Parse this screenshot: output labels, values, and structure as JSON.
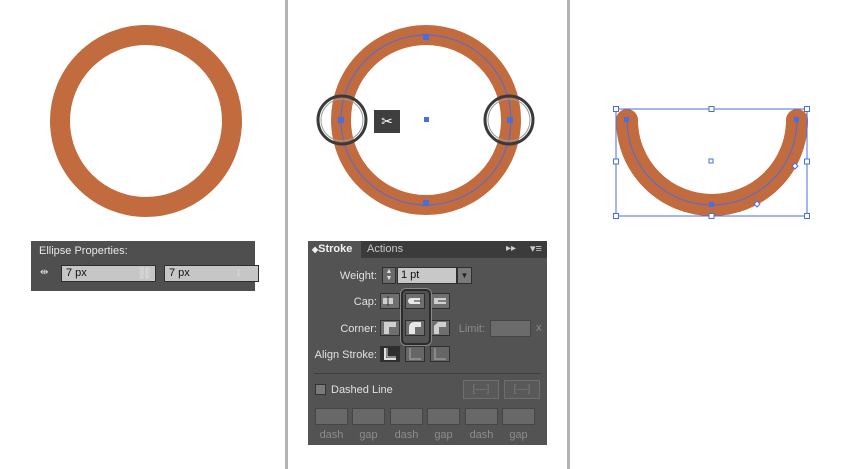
{
  "colors": {
    "accent": "#c16b3f",
    "selection": "#4a6de0"
  },
  "ellipse_properties": {
    "title": "Ellipse Properties:",
    "width_value": "7 px",
    "height_value": "7 px"
  },
  "stroke_panel": {
    "tabs": [
      "Stroke",
      "Actions"
    ],
    "weight_label": "Weight:",
    "weight_value": "1 pt",
    "cap_label": "Cap:",
    "corner_label": "Corner:",
    "limit_label": "Limit:",
    "limit_unit": "x",
    "align_label": "Align Stroke:",
    "dashed_label": "Dashed Line",
    "dash_labels": [
      "dash",
      "gap",
      "dash",
      "gap",
      "dash",
      "gap"
    ]
  },
  "icons": [
    "scissors-icon",
    "link-icon",
    "menu-icon",
    "double-arrow-icon"
  ]
}
